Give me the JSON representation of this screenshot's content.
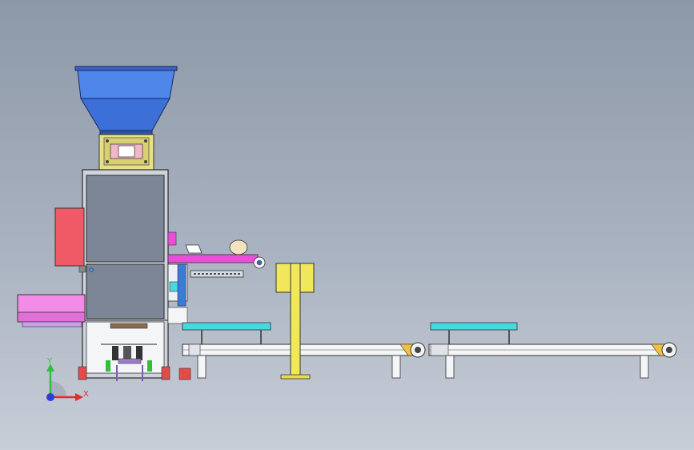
{
  "triad": {
    "y_label": "Y",
    "x_label": "X",
    "y_color": "#2fbf3a",
    "x_color": "#e32b2b",
    "z_color": "#2a3fd6"
  },
  "colors": {
    "background_top": "#8c98a8",
    "background_bottom": "#c8ced8",
    "hopper": "#4a7fe6",
    "frame": "#7c8594",
    "panel_red": "#f05a66",
    "side_magenta": "#f28ae8",
    "belt_magenta": "#e84fd6",
    "weigh_yellow": "#e8e070",
    "conveyor_cyan": "#48d8e0",
    "stand_yellow": "#f0e85a",
    "bag": "#f2e2c0"
  }
}
